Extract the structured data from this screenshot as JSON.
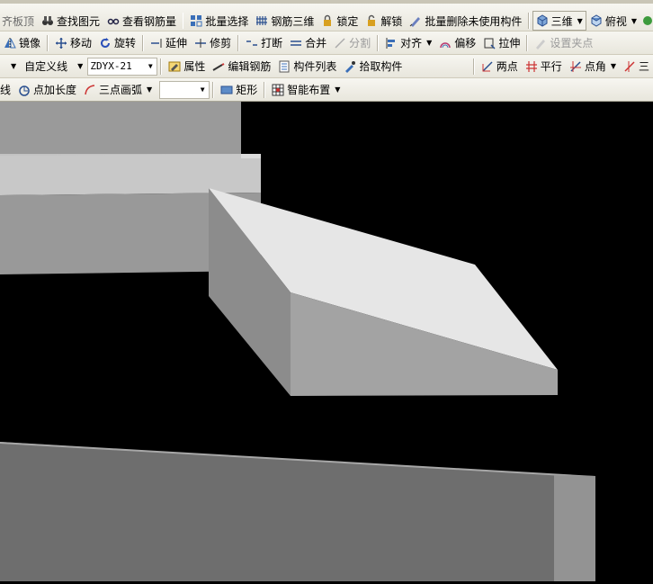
{
  "toolbar1": {
    "floor_slab_partial": "齐板顶",
    "find_element": "查找图元",
    "view_rebar_qty": "查看钢筋量",
    "batch_select": "批量选择",
    "rebar_3d": "钢筋三维",
    "lock": "锁定",
    "unlock": "解锁",
    "batch_delete_unused": "批量删除未使用构件",
    "view_3d": "三维",
    "top_view": "俯视"
  },
  "toolbar2": {
    "mirror": "镜像",
    "move": "移动",
    "rotate": "旋转",
    "extend": "延伸",
    "trim": "修剪",
    "break": "打断",
    "merge": "合并",
    "split": "分割",
    "align": "对齐",
    "offset": "偏移",
    "stretch": "拉伸",
    "set_grip": "设置夹点"
  },
  "toolbar3": {
    "line_type": "自定义线",
    "component_code": "ZDYX-21",
    "properties": "属性",
    "edit_rebar": "编辑钢筋",
    "component_list": "构件列表",
    "pick_component": "拾取构件",
    "two_points": "两点",
    "parallel": "平行",
    "point_angle": "点角",
    "three": "三"
  },
  "toolbar4": {
    "line": "线",
    "point_plus_length": "点加长度",
    "three_point_arc": "三点画弧",
    "arc_option": "",
    "rectangle": "矩形",
    "smart_layout": "智能布置"
  }
}
